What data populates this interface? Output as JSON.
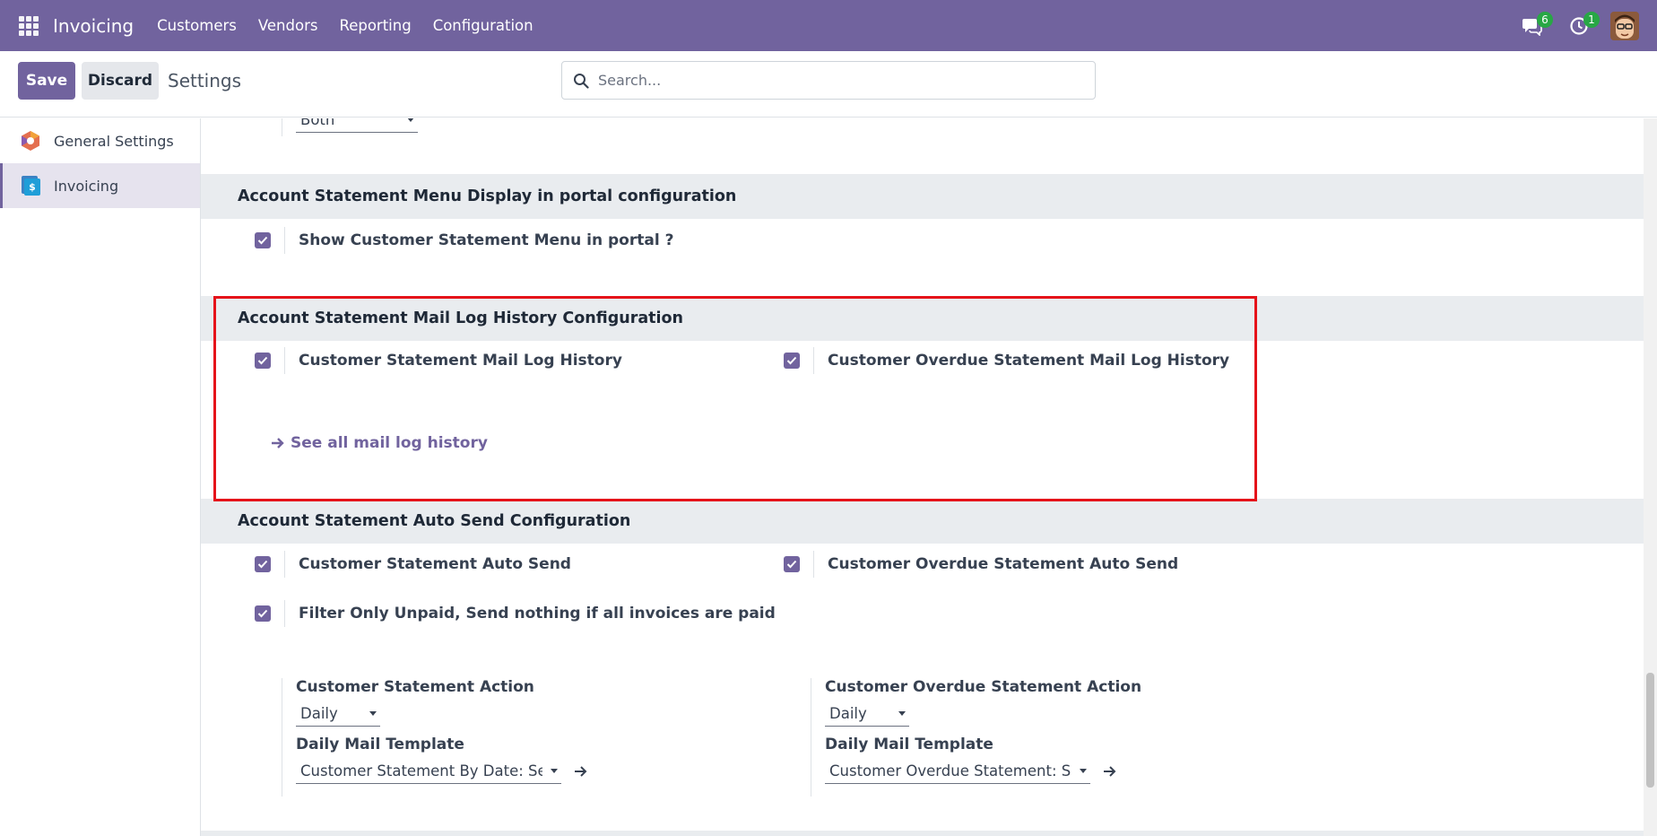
{
  "navbar": {
    "app_name": "Invoicing",
    "menu": [
      "Customers",
      "Vendors",
      "Reporting",
      "Configuration"
    ],
    "messages_count": "6",
    "activities_count": "1",
    "color": "#71639e"
  },
  "control_panel": {
    "save_label": "Save",
    "discard_label": "Discard",
    "title": "Settings",
    "search_placeholder": "Search..."
  },
  "sidebar": {
    "items": [
      {
        "label": "General Settings",
        "icon": "general-settings-icon"
      },
      {
        "label": "Invoicing",
        "icon": "invoicing-icon",
        "active": true
      }
    ]
  },
  "content": {
    "top_select_value": "Both",
    "sections": [
      {
        "title": "Account Statement Menu Display in portal configuration",
        "settings": [
          {
            "label": "Show Customer Statement Menu in portal ?",
            "checked": true
          }
        ]
      },
      {
        "title": "Account Statement Mail Log History Configuration",
        "settings": [
          {
            "label": "Customer Statement Mail Log History",
            "checked": true
          },
          {
            "label": "Customer Overdue Statement Mail Log History",
            "checked": true
          }
        ],
        "link": "See all mail log history"
      },
      {
        "title": "Account Statement Auto Send Configuration",
        "settings": [
          {
            "label": "Customer Statement Auto Send",
            "checked": true
          },
          {
            "label": "Customer Overdue Statement Auto Send",
            "checked": true
          },
          {
            "label": "Filter Only Unpaid, Send nothing if all invoices are paid",
            "checked": true
          }
        ],
        "left_block": {
          "action_title": "Customer Statement Action",
          "action_value": "Daily",
          "template_title": "Daily Mail Template",
          "template_value": "Customer Statement By Date: Send"
        },
        "right_block": {
          "action_title": "Customer Overdue Statement Action",
          "action_value": "Daily",
          "template_title": "Daily Mail Template",
          "template_value": "Customer Overdue Statement: Send"
        }
      }
    ]
  },
  "highlight_color": "#e5131a"
}
